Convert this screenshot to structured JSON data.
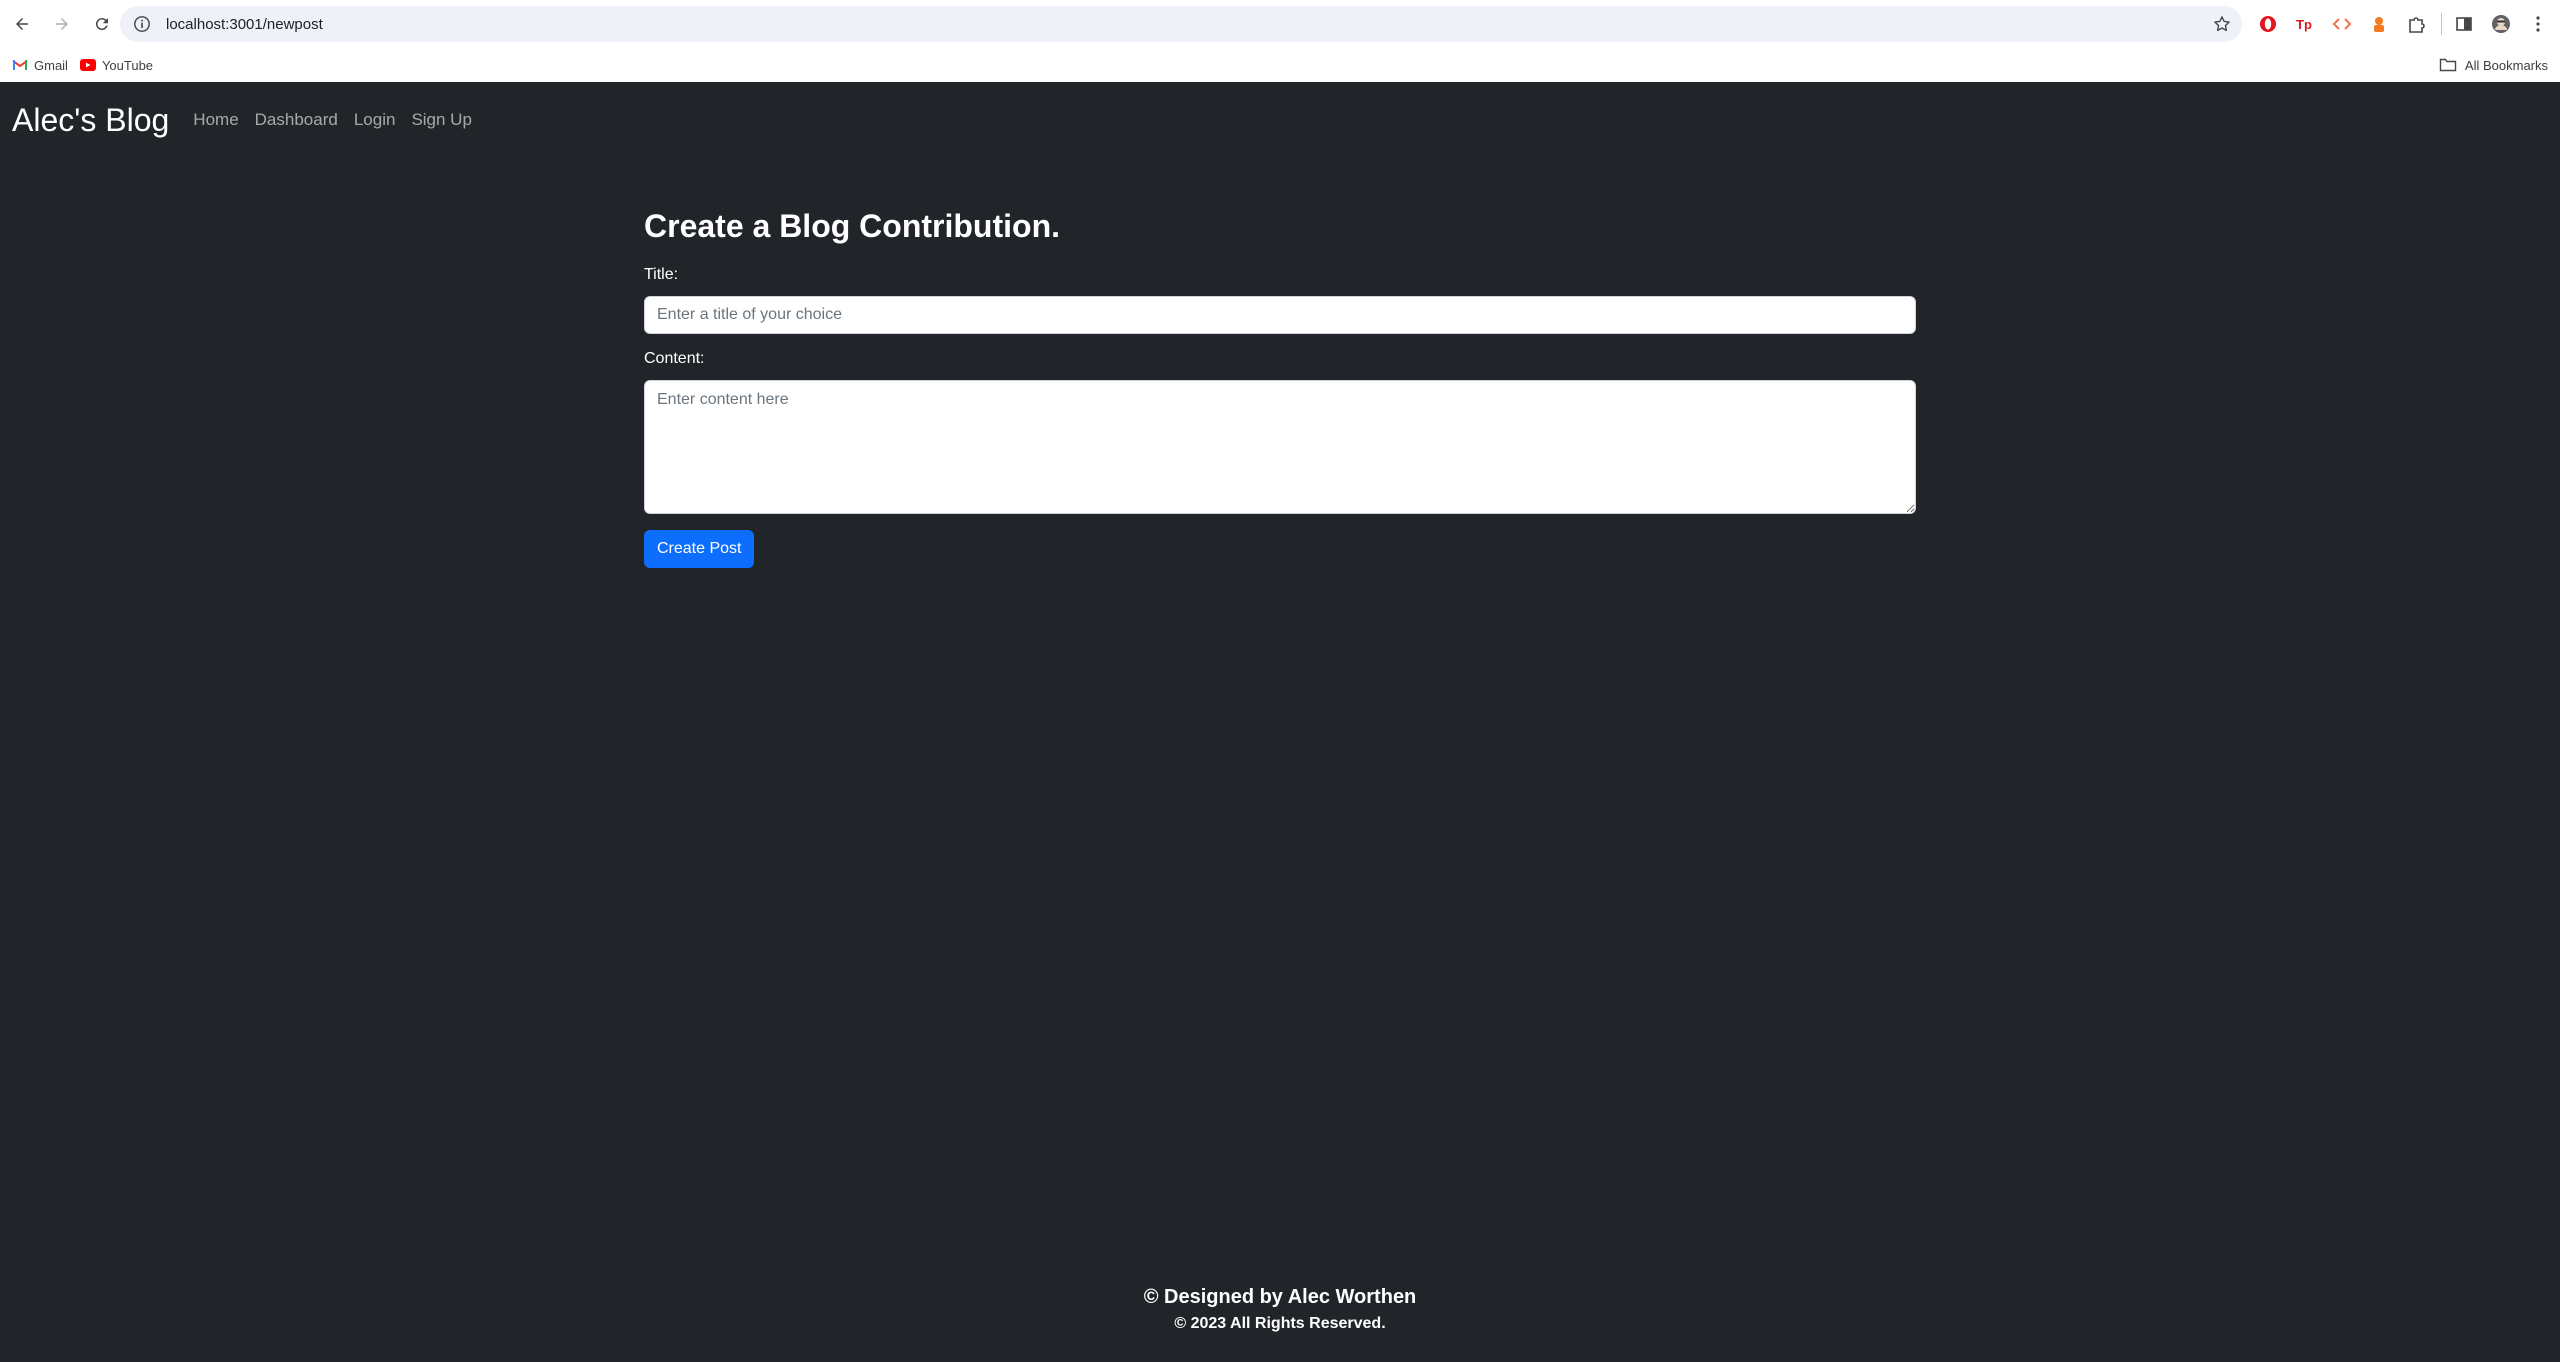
{
  "browser": {
    "url": "localhost:3001/newpost",
    "bookmarks": [
      {
        "label": "Gmail",
        "icon": "gmail-icon"
      },
      {
        "label": "YouTube",
        "icon": "youtube-icon"
      }
    ],
    "all_bookmarks_label": "All Bookmarks",
    "extensions": [
      "opera-extension-icon",
      "tp-extension-icon",
      "code-extension-icon",
      "extension-orange-icon",
      "puzzle-icon"
    ]
  },
  "site": {
    "brand": "Alec's Blog",
    "nav": [
      "Home",
      "Dashboard",
      "Login",
      "Sign Up"
    ]
  },
  "form": {
    "heading": "Create a Blog Contribution.",
    "title_label": "Title:",
    "title_placeholder": "Enter a title of your choice",
    "title_value": "",
    "content_label": "Content:",
    "content_placeholder": "Enter content here",
    "content_value": "",
    "submit_label": "Create Post"
  },
  "footer": {
    "designed_by": "© Designed by Alec Worthen",
    "copyright": "© 2023 All Rights Reserved."
  },
  "colors": {
    "page_bg": "#212529",
    "primary_button": "#0d6efd",
    "nav_link": "rgba(255,255,255,0.6)"
  }
}
